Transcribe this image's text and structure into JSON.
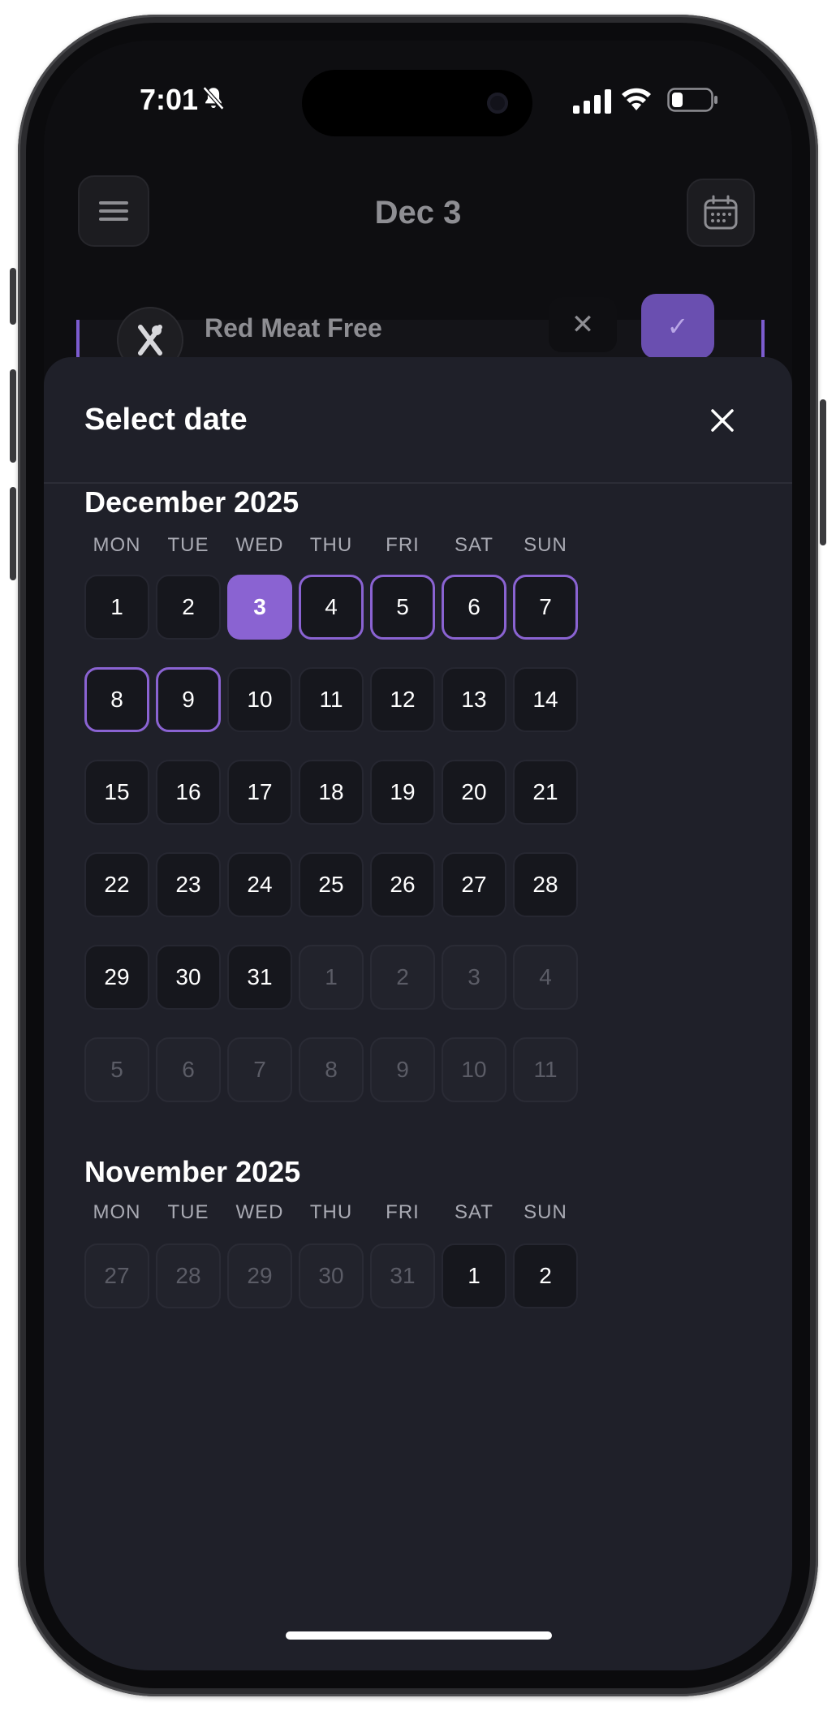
{
  "status": {
    "time": "7:01"
  },
  "header": {
    "title": "Dec 3"
  },
  "behind_card": {
    "label": "Red Meat Free"
  },
  "sheet": {
    "title": "Select date",
    "weekdays": [
      "MON",
      "TUE",
      "WED",
      "THU",
      "FRI",
      "SAT",
      "SUN"
    ],
    "months": [
      {
        "title": "December 2025",
        "weeks": [
          [
            {
              "d": "1",
              "s": "normal"
            },
            {
              "d": "2",
              "s": "normal"
            },
            {
              "d": "3",
              "s": "selected"
            },
            {
              "d": "4",
              "s": "range"
            },
            {
              "d": "5",
              "s": "range"
            },
            {
              "d": "6",
              "s": "range"
            },
            {
              "d": "7",
              "s": "range"
            }
          ],
          [
            {
              "d": "8",
              "s": "range"
            },
            {
              "d": "9",
              "s": "range"
            },
            {
              "d": "10",
              "s": "normal"
            },
            {
              "d": "11",
              "s": "normal"
            },
            {
              "d": "12",
              "s": "normal"
            },
            {
              "d": "13",
              "s": "normal"
            },
            {
              "d": "14",
              "s": "normal"
            }
          ],
          [
            {
              "d": "15",
              "s": "normal"
            },
            {
              "d": "16",
              "s": "normal"
            },
            {
              "d": "17",
              "s": "normal"
            },
            {
              "d": "18",
              "s": "normal"
            },
            {
              "d": "19",
              "s": "normal"
            },
            {
              "d": "20",
              "s": "normal"
            },
            {
              "d": "21",
              "s": "normal"
            }
          ],
          [
            {
              "d": "22",
              "s": "normal"
            },
            {
              "d": "23",
              "s": "normal"
            },
            {
              "d": "24",
              "s": "normal"
            },
            {
              "d": "25",
              "s": "normal"
            },
            {
              "d": "26",
              "s": "normal"
            },
            {
              "d": "27",
              "s": "normal"
            },
            {
              "d": "28",
              "s": "normal"
            }
          ],
          [
            {
              "d": "29",
              "s": "normal"
            },
            {
              "d": "30",
              "s": "normal"
            },
            {
              "d": "31",
              "s": "normal"
            },
            {
              "d": "1",
              "s": "muted"
            },
            {
              "d": "2",
              "s": "muted"
            },
            {
              "d": "3",
              "s": "muted"
            },
            {
              "d": "4",
              "s": "muted"
            }
          ],
          [
            {
              "d": "5",
              "s": "muted"
            },
            {
              "d": "6",
              "s": "muted"
            },
            {
              "d": "7",
              "s": "muted"
            },
            {
              "d": "8",
              "s": "muted"
            },
            {
              "d": "9",
              "s": "muted"
            },
            {
              "d": "10",
              "s": "muted"
            },
            {
              "d": "11",
              "s": "muted"
            }
          ]
        ]
      },
      {
        "title": "November 2025",
        "weeks": [
          [
            {
              "d": "27",
              "s": "muted"
            },
            {
              "d": "28",
              "s": "muted"
            },
            {
              "d": "29",
              "s": "muted"
            },
            {
              "d": "30",
              "s": "muted"
            },
            {
              "d": "31",
              "s": "muted"
            },
            {
              "d": "1",
              "s": "normal"
            },
            {
              "d": "2",
              "s": "normal"
            }
          ]
        ]
      }
    ]
  },
  "colors": {
    "accent": "#8a63d2",
    "sheet_bg": "#1f2029",
    "cell_bg": "#16171d"
  },
  "icons": {
    "menu": "hamburger-icon",
    "calendar": "calendar-icon",
    "close": "close-icon",
    "diet": "no-meat-icon"
  }
}
